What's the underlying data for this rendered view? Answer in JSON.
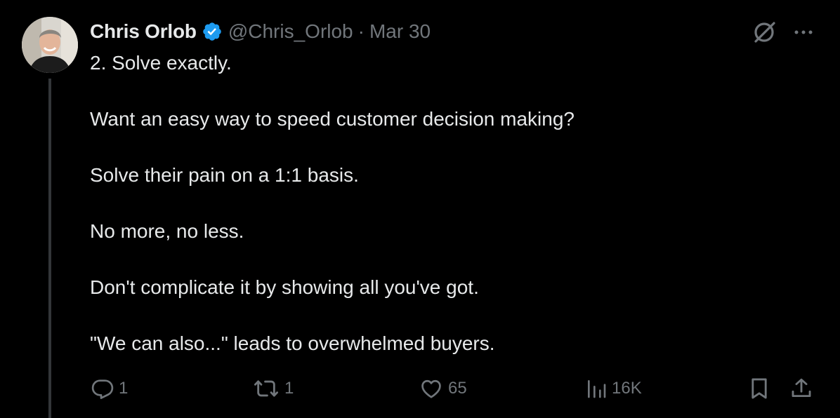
{
  "tweet": {
    "author_name": "Chris Orlob",
    "author_handle": "@Chris_Orlob",
    "separator": "·",
    "date": "Mar 30",
    "lines": [
      "2. Solve exactly.",
      "Want an easy way to speed customer decision making?",
      "Solve their pain on a 1:1 basis.",
      "No more, no less.",
      "Don't complicate it by showing all you've got.",
      "\"We can also...\" leads to overwhelmed buyers."
    ],
    "stats": {
      "replies": "1",
      "reposts": "1",
      "likes": "65",
      "views": "16K"
    }
  },
  "colors": {
    "background": "#000000",
    "text": "#e7e9ea",
    "muted": "#71767b",
    "verified": "#1d9bf0",
    "thread_line": "#333639"
  },
  "icons": [
    "verified-badge-icon",
    "grok-icon",
    "more-icon",
    "reply-icon",
    "repost-icon",
    "like-icon",
    "views-icon",
    "bookmark-icon",
    "share-icon"
  ]
}
